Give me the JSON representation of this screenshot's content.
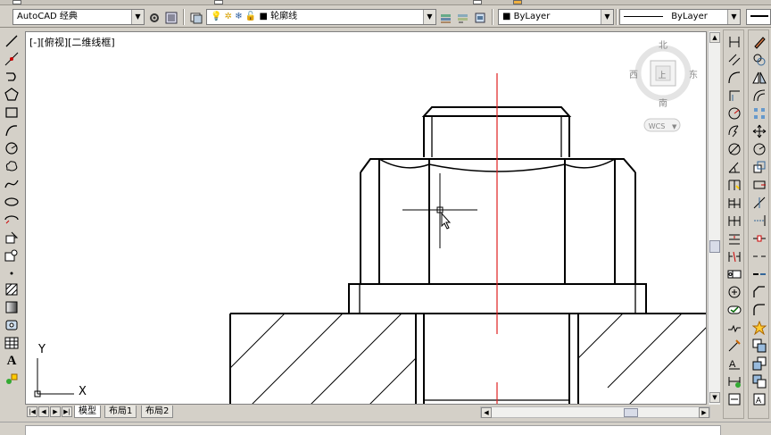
{
  "toolbar": {
    "workspace": "AutoCAD 经典",
    "layer": "轮廓线",
    "color": "ByLayer",
    "linetype": "ByLayer"
  },
  "viewport": {
    "label": "[-][俯视][二维线框]"
  },
  "viewcube": {
    "north": "北",
    "south": "南",
    "east": "东",
    "west": "西",
    "wcs": "WCS"
  },
  "ucs": {
    "x": "X",
    "y": "Y"
  },
  "tabs": [
    "模型",
    "布局1",
    "布局2"
  ],
  "left_tools": [
    "line-icon",
    "construction-line-icon",
    "polyline-icon",
    "polygon-icon",
    "rectangle-icon",
    "arc-icon",
    "circle-icon",
    "revision-cloud-icon",
    "spline-icon",
    "ellipse-icon",
    "ellipse-arc-icon",
    "insert-block-icon",
    "make-block-icon",
    "point-icon",
    "hatch-icon",
    "gradient-icon",
    "region-icon",
    "table-icon",
    "mtext-icon",
    "add-selected-icon"
  ],
  "right_tools_col1": [
    "dimension-linear-icon",
    "dimension-aligned-icon",
    "dimension-arc-icon",
    "dimension-ordinate-icon",
    "dimension-radius-icon",
    "dimension-jogged-icon",
    "dimension-diameter-icon",
    "dimension-angular-icon",
    "quick-dimension-icon",
    "dimension-baseline-icon",
    "dimension-continue-icon",
    "dimension-space-icon",
    "dimension-break-icon",
    "tolerance-icon",
    "center-mark-icon",
    "inspection-icon",
    "jogged-linear-icon",
    "dimension-edit-icon",
    "dimension-text-edit-icon",
    "dimension-update-icon"
  ],
  "right_tools_col2": [
    "erase-icon",
    "copy-icon",
    "mirror-icon",
    "offset-icon",
    "array-icon",
    "move-icon",
    "rotate-icon",
    "scale-icon",
    "stretch-icon",
    "trim-icon",
    "extend-icon",
    "break-at-point-icon",
    "break-icon",
    "join-icon",
    "chamfer-icon",
    "fillet-icon",
    "explode-icon",
    "draw-order-icon",
    "bring-front-icon",
    "send-back-icon"
  ]
}
